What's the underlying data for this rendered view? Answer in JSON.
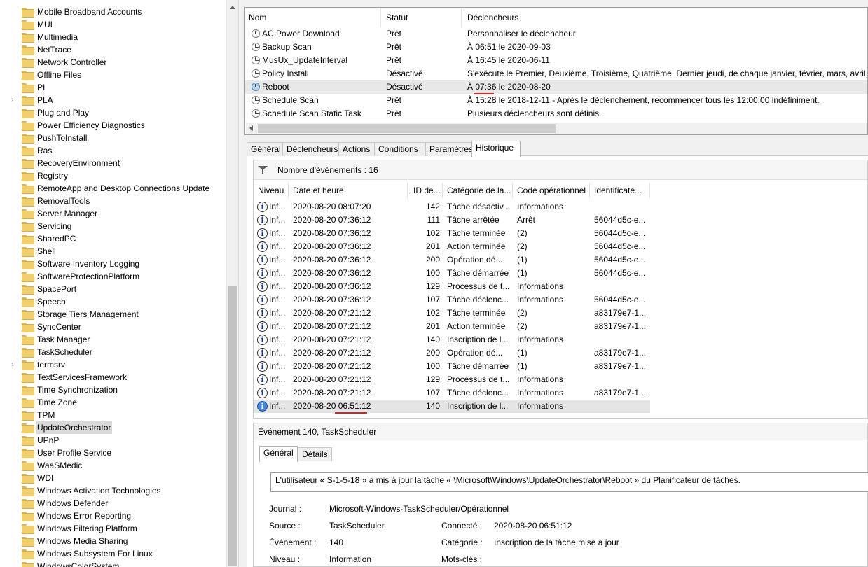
{
  "tree": {
    "items": [
      {
        "label": "Mobile Broadband Accounts",
        "expandable": false
      },
      {
        "label": "MUI",
        "expandable": false
      },
      {
        "label": "Multimedia",
        "expandable": false
      },
      {
        "label": "NetTrace",
        "expandable": false
      },
      {
        "label": "Network Controller",
        "expandable": false
      },
      {
        "label": "Offline Files",
        "expandable": false
      },
      {
        "label": "PI",
        "expandable": false
      },
      {
        "label": "PLA",
        "expandable": true
      },
      {
        "label": "Plug and Play",
        "expandable": false
      },
      {
        "label": "Power Efficiency Diagnostics",
        "expandable": false
      },
      {
        "label": "PushToInstall",
        "expandable": false
      },
      {
        "label": "Ras",
        "expandable": false
      },
      {
        "label": "RecoveryEnvironment",
        "expandable": false
      },
      {
        "label": "Registry",
        "expandable": false
      },
      {
        "label": "RemoteApp and Desktop Connections Update",
        "expandable": false
      },
      {
        "label": "RemovalTools",
        "expandable": false
      },
      {
        "label": "Server Manager",
        "expandable": false
      },
      {
        "label": "Servicing",
        "expandable": false
      },
      {
        "label": "SharedPC",
        "expandable": false
      },
      {
        "label": "Shell",
        "expandable": false
      },
      {
        "label": "Software Inventory Logging",
        "expandable": false
      },
      {
        "label": "SoftwareProtectionPlatform",
        "expandable": false
      },
      {
        "label": "SpacePort",
        "expandable": false
      },
      {
        "label": "Speech",
        "expandable": false
      },
      {
        "label": "Storage Tiers Management",
        "expandable": false
      },
      {
        "label": "SyncCenter",
        "expandable": false
      },
      {
        "label": "Task Manager",
        "expandable": false
      },
      {
        "label": "TaskScheduler",
        "expandable": false
      },
      {
        "label": "termsrv",
        "expandable": true
      },
      {
        "label": "TextServicesFramework",
        "expandable": false
      },
      {
        "label": "Time Synchronization",
        "expandable": false
      },
      {
        "label": "Time Zone",
        "expandable": false
      },
      {
        "label": "TPM",
        "expandable": false
      },
      {
        "label": "UpdateOrchestrator",
        "expandable": false,
        "selected": true
      },
      {
        "label": "UPnP",
        "expandable": false
      },
      {
        "label": "User Profile Service",
        "expandable": false
      },
      {
        "label": "WaaSMedic",
        "expandable": false
      },
      {
        "label": "WDI",
        "expandable": false
      },
      {
        "label": "Windows Activation Technologies",
        "expandable": false
      },
      {
        "label": "Windows Defender",
        "expandable": false
      },
      {
        "label": "Windows Error Reporting",
        "expandable": false
      },
      {
        "label": "Windows Filtering Platform",
        "expandable": false
      },
      {
        "label": "Windows Media Sharing",
        "expandable": false
      },
      {
        "label": "Windows Subsystem For Linux",
        "expandable": false
      },
      {
        "label": "WindowsColorSystem",
        "expandable": false
      }
    ]
  },
  "tasks": {
    "columns": {
      "name": "Nom",
      "status": "Statut",
      "triggers": "Déclencheurs"
    },
    "rows": [
      {
        "name": "AC Power Download",
        "status": "Prêt",
        "trigger": "Personnaliser le déclencheur"
      },
      {
        "name": "Backup Scan",
        "status": "Prêt",
        "trigger": "À 06:51 le 2020-09-03"
      },
      {
        "name": "MusUx_UpdateInterval",
        "status": "Prêt",
        "trigger": "À 16:45 le 2020-06-11"
      },
      {
        "name": "Policy Install",
        "status": "Désactivé",
        "trigger": "S'exécute le Premier, Deuxième, Troisième, Quatrième, Dernier jeudi, de chaque janvier, février, mars, avril, mai"
      },
      {
        "name": "Reboot",
        "status": "Désactivé",
        "trigger": "À 07:36 le 2020-08-20",
        "highlight": true
      },
      {
        "name": "Schedule Scan",
        "status": "Prêt",
        "trigger": "À 15:28 le 2018-12-11 - Après le déclenchement, recommencer tous les 12:00:00 indéfiniment."
      },
      {
        "name": "Schedule Scan Static Task",
        "status": "Prêt",
        "trigger": "Plusieurs déclencheurs sont définis."
      }
    ]
  },
  "tabs": [
    {
      "label": "Général"
    },
    {
      "label": "Déclencheurs"
    },
    {
      "label": "Actions"
    },
    {
      "label": "Conditions"
    },
    {
      "label": "Paramètres"
    },
    {
      "label": "Historique",
      "active": true
    }
  ],
  "history": {
    "event_count_label": "Nombre d'événements : 16",
    "columns": {
      "level": "Niveau",
      "datetime": "Date et heure",
      "id": "ID de...",
      "category": "Catégorie de la...",
      "opcode": "Code opérationnel",
      "activity": "Identificate..."
    },
    "rows": [
      {
        "level": "Inf...",
        "datetime": "2020-08-20 08:07:20",
        "id": "142",
        "category": "Tâche désactiv...",
        "opcode": "Informations",
        "activity": ""
      },
      {
        "level": "Inf...",
        "datetime": "2020-08-20 07:36:12",
        "id": "111",
        "category": "Tâche arrêtée",
        "opcode": "Arrêt",
        "activity": "56044d5c-e..."
      },
      {
        "level": "Inf...",
        "datetime": "2020-08-20 07:36:12",
        "id": "102",
        "category": "Tâche terminée",
        "opcode": "(2)",
        "activity": "56044d5c-e..."
      },
      {
        "level": "Inf...",
        "datetime": "2020-08-20 07:36:12",
        "id": "201",
        "category": "Action terminée",
        "opcode": "(2)",
        "activity": "56044d5c-e..."
      },
      {
        "level": "Inf...",
        "datetime": "2020-08-20 07:36:12",
        "id": "200",
        "category": "Opération dé...",
        "opcode": "(1)",
        "activity": "56044d5c-e..."
      },
      {
        "level": "Inf...",
        "datetime": "2020-08-20 07:36:12",
        "id": "100",
        "category": "Tâche démarrée",
        "opcode": "(1)",
        "activity": "56044d5c-e..."
      },
      {
        "level": "Inf...",
        "datetime": "2020-08-20 07:36:12",
        "id": "129",
        "category": "Processus de t...",
        "opcode": "Informations",
        "activity": ""
      },
      {
        "level": "Inf...",
        "datetime": "2020-08-20 07:36:12",
        "id": "107",
        "category": "Tâche déclenc...",
        "opcode": "Informations",
        "activity": "56044d5c-e..."
      },
      {
        "level": "Inf...",
        "datetime": "2020-08-20 07:21:12",
        "id": "102",
        "category": "Tâche terminée",
        "opcode": "(2)",
        "activity": "a83179e7-1..."
      },
      {
        "level": "Inf...",
        "datetime": "2020-08-20 07:21:12",
        "id": "201",
        "category": "Action terminée",
        "opcode": "(2)",
        "activity": "a83179e7-1..."
      },
      {
        "level": "Inf...",
        "datetime": "2020-08-20 07:21:12",
        "id": "140",
        "category": "Inscription de l...",
        "opcode": "Informations",
        "activity": ""
      },
      {
        "level": "Inf...",
        "datetime": "2020-08-20 07:21:12",
        "id": "200",
        "category": "Opération dé...",
        "opcode": "(1)",
        "activity": "a83179e7-1..."
      },
      {
        "level": "Inf...",
        "datetime": "2020-08-20 07:21:12",
        "id": "100",
        "category": "Tâche démarrée",
        "opcode": "(1)",
        "activity": "a83179e7-1..."
      },
      {
        "level": "Inf...",
        "datetime": "2020-08-20 07:21:12",
        "id": "129",
        "category": "Processus de t...",
        "opcode": "Informations",
        "activity": ""
      },
      {
        "level": "Inf...",
        "datetime": "2020-08-20 07:21:12",
        "id": "107",
        "category": "Tâche déclenc...",
        "opcode": "Informations",
        "activity": "a83179e7-1..."
      },
      {
        "level": "Inf...",
        "datetime": "2020-08-20 06:51:12",
        "id": "140",
        "category": "Inscription de l...",
        "opcode": "Informations",
        "activity": "",
        "selected": true
      }
    ]
  },
  "event": {
    "title": "Événement 140, TaskScheduler",
    "tab_general": "Général",
    "tab_details": "Détails",
    "message": "L'utilisateur « S-1-5-18 » a mis à jour la tâche « \\Microsoft\\Windows\\UpdateOrchestrator\\Reboot » du Planificateur de tâches.",
    "fields": {
      "journal_label": "Journal :",
      "journal_value": "Microsoft-Windows-TaskScheduler/Opérationnel",
      "source_label": "Source :",
      "source_value": "TaskScheduler",
      "logged_label": "Connecté :",
      "logged_value": "2020-08-20 06:51:12",
      "event_label": "Événement :",
      "event_value": "140",
      "category_label": "Catégorie :",
      "category_value": "Inscription de la tâche mise à jour",
      "level_label": "Niveau :",
      "level_value": "Information",
      "keywords_label": "Mots-clés :"
    }
  },
  "colors": {
    "annotation_underline": "#e02020",
    "selection": "#d9d9d9"
  }
}
